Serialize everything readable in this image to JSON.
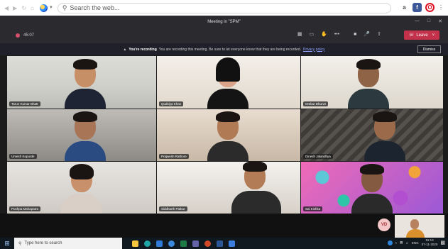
{
  "browser": {
    "search_placeholder": "Search the web...",
    "icon_names": [
      "back-icon",
      "forward-icon",
      "reload-icon",
      "home-icon",
      "browser-logo-icon",
      "search-icon",
      "account-icon",
      "facebook-icon",
      "opera-icon"
    ]
  },
  "window": {
    "title": "Meeting in \"SPM\""
  },
  "meeting": {
    "timer": "45:07",
    "leave_label": "Leave"
  },
  "banner": {
    "lead": "You're recording",
    "message": "You are recording this meeting. Be sure to let everyone know that they are being recorded.",
    "link": "Privacy policy",
    "dismiss": "Dismiss"
  },
  "participants": [
    {
      "name": "Tarun Kumar Bhatt"
    },
    {
      "name": "Qudsiya Khan"
    },
    {
      "name": "Omkar Dhurve"
    },
    {
      "name": "Umesh Kopurde"
    },
    {
      "name": "Prajwesh Rathore"
    },
    {
      "name": "Dinesh Jalandhya"
    },
    {
      "name": "Pushpa Mahapatra"
    },
    {
      "name": "Siddharth Patkar"
    },
    {
      "name": "Sai Kishka"
    }
  ],
  "self_avatar": "VD",
  "taskbar": {
    "search_placeholder": "Type here to search",
    "language": "ENG",
    "time": "15:13",
    "date": "07-11-2020"
  },
  "colors": {
    "leave": "#c4314b",
    "teams_bg": "#2b2b2f",
    "taskbar": "#101820"
  }
}
